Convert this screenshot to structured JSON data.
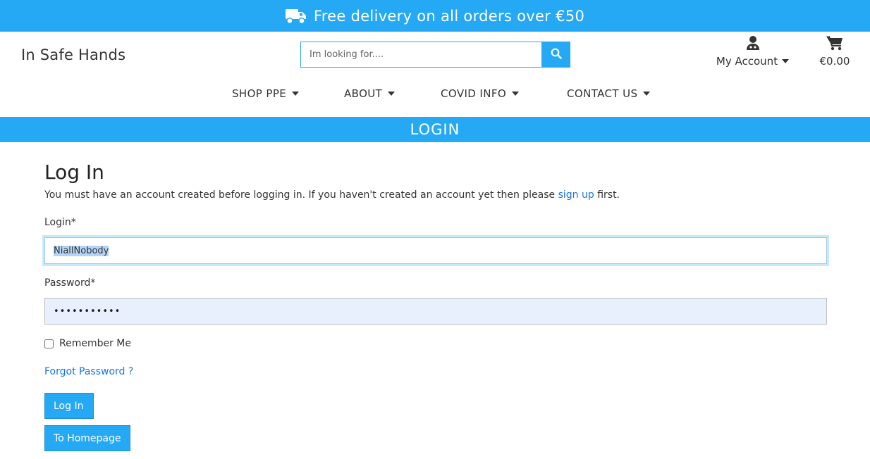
{
  "promo": {
    "text": "Free delivery on all orders over €50",
    "icon": "truck-icon"
  },
  "brand": {
    "name": "In Safe Hands"
  },
  "search": {
    "placeholder": "Im looking for....",
    "icon": "search-icon"
  },
  "account": {
    "label": "My Account",
    "icon": "user-doctor-icon"
  },
  "cart": {
    "total": "€0.00",
    "icon": "shopping-cart-icon"
  },
  "nav": {
    "items": [
      {
        "label": "SHOP PPE"
      },
      {
        "label": "ABOUT"
      },
      {
        "label": "COVID INFO"
      },
      {
        "label": "CONTACT US"
      }
    ]
  },
  "banner": {
    "title": "LOGIN"
  },
  "login_form": {
    "heading": "Log In",
    "intro_before": "You must have an account created before logging in. If you haven't created an account yet then please ",
    "intro_link": "sign up",
    "intro_after": " first.",
    "login_label": "Login*",
    "login_value": "NiallNobody",
    "password_label": "Password*",
    "password_mask": "•••••••••••",
    "remember_label": "Remember Me",
    "forgot_link": "Forgot Password ?",
    "submit_label": "Log In",
    "homepage_label": "To Homepage"
  },
  "colors": {
    "accent": "#25a9f4",
    "link": "#1a73e8"
  }
}
